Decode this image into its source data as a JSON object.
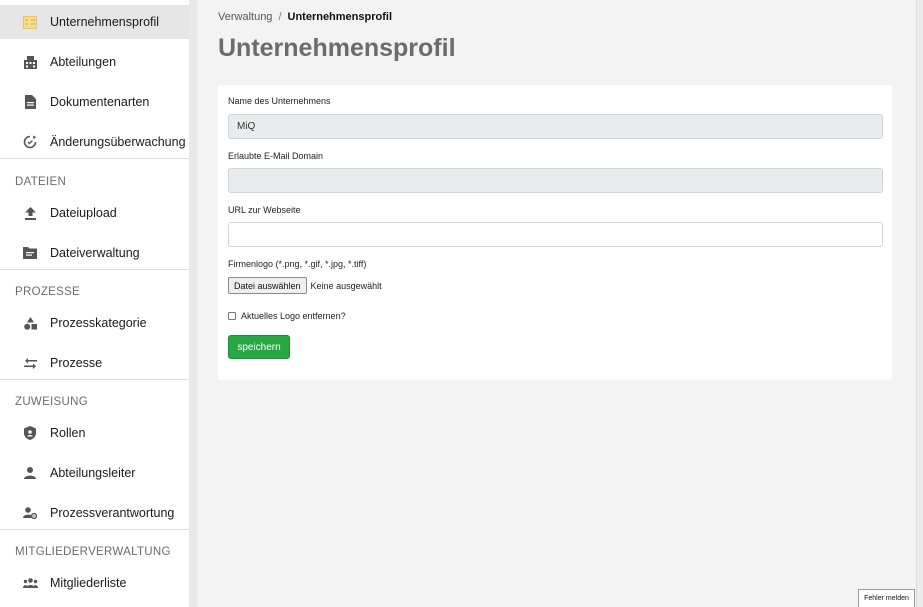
{
  "sidebar": {
    "items": [
      {
        "name": "unternehmensprofil",
        "label": "Unternehmensprofil",
        "icon": "building-icon",
        "active": true
      },
      {
        "name": "abteilungen",
        "label": "Abteilungen",
        "icon": "office-building-icon"
      },
      {
        "name": "dokumentenarten",
        "label": "Dokumentenarten",
        "icon": "document-icon"
      },
      {
        "name": "aenderungsueberwachung",
        "label": "Änderungsüberwachung",
        "icon": "sync-watch-icon"
      },
      {
        "name": "dateiupload",
        "label": "Dateiupload",
        "icon": "upload-icon"
      },
      {
        "name": "dateiverwaltung",
        "label": "Dateiverwaltung",
        "icon": "folder-icon"
      },
      {
        "name": "prozesskategorie",
        "label": "Prozesskategorie",
        "icon": "category-shapes-icon"
      },
      {
        "name": "prozesse",
        "label": "Prozesse",
        "icon": "swap-arrows-icon"
      },
      {
        "name": "rollen",
        "label": "Rollen",
        "icon": "shield-user-icon"
      },
      {
        "name": "abteilungsleiter",
        "label": "Abteilungsleiter",
        "icon": "person-icon"
      },
      {
        "name": "prozessverantwortung",
        "label": "Prozessverantwortung",
        "icon": "person-gear-icon"
      },
      {
        "name": "mitgliederliste",
        "label": "Mitgliederliste",
        "icon": "group-icon"
      }
    ],
    "sections": {
      "dateien": "DATEIEN",
      "prozesse": "PROZESSE",
      "zuweisung": "ZUWEISUNG",
      "mitgliederverwaltung": "MITGLIEDERVERWALTUNG"
    }
  },
  "breadcrumb": {
    "parent": "Verwaltung",
    "separator": "/",
    "current": "Unternehmensprofil"
  },
  "page_title": "Unternehmensprofil",
  "form": {
    "company_name_label": "Name des Unternehmens",
    "company_name_value": "MiQ",
    "email_domain_label": "Erlaubte E-Mail Domain",
    "email_domain_value": "",
    "website_label": "URL zur Webseite",
    "website_value": "",
    "logo_label": "Firmenlogo (*.png, *.gif, *.jpg, *.tiff)",
    "file_button_label": "Datei auswählen",
    "file_status": "Keine ausgewählt",
    "remove_logo_label": "Aktuelles Logo entfernen?",
    "remove_logo_checked": false,
    "save_label": "speichern"
  },
  "report_button_label": "Fehler melden",
  "colors": {
    "accent_green": "#28a745",
    "active_icon": "#e8c35a",
    "title_gray": "#6b6b6b"
  }
}
